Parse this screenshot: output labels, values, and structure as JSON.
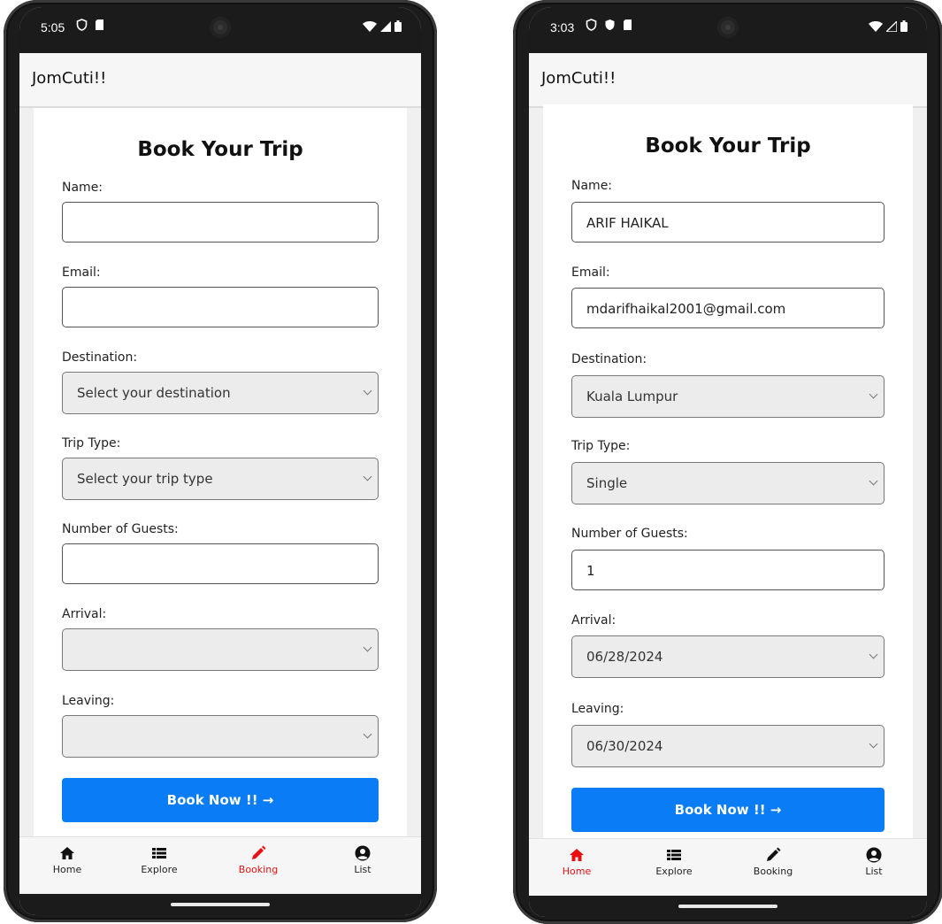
{
  "left_phone": {
    "status": {
      "time": "5:05"
    },
    "app_title": "JomCuti!!",
    "form": {
      "heading": "Book Your Trip",
      "name_label": "Name:",
      "name_value": "",
      "email_label": "Email:",
      "email_value": "",
      "destination_label": "Destination:",
      "destination_value": "Select your destination",
      "trip_type_label": "Trip Type:",
      "trip_type_value": "Select your trip type",
      "guests_label": "Number of Guests:",
      "guests_value": "",
      "arrival_label": "Arrival:",
      "arrival_value": "",
      "leaving_label": "Leaving:",
      "leaving_value": "",
      "book_button": "Book Now !! →"
    },
    "nav": {
      "items": [
        "Home",
        "Explore",
        "Booking",
        "List"
      ],
      "active": "Booking"
    }
  },
  "right_phone": {
    "status": {
      "time": "3:03"
    },
    "app_title": "JomCuti!!",
    "form": {
      "heading": "Book Your Trip",
      "name_label": "Name:",
      "name_value": "ARIF HAIKAL",
      "email_label": "Email:",
      "email_value": "mdarifhaikal2001@gmail.com",
      "destination_label": "Destination:",
      "destination_value": "Kuala Lumpur",
      "trip_type_label": "Trip Type:",
      "trip_type_value": "Single",
      "guests_label": "Number of Guests:",
      "guests_value": "1",
      "arrival_label": "Arrival:",
      "arrival_value": "06/28/2024",
      "leaving_label": "Leaving:",
      "leaving_value": "06/30/2024",
      "book_button": "Book Now !! →"
    },
    "nav": {
      "items": [
        "Home",
        "Explore",
        "Booking",
        "List"
      ],
      "active": "Home"
    }
  },
  "colors": {
    "accent_blue": "#0a7cf6",
    "active_red": "#e81010",
    "select_bg": "#ececec"
  },
  "icons": [
    "shield-icon",
    "sim-icon",
    "wifi-icon",
    "signal-icon",
    "battery-icon",
    "home-icon",
    "list-icon",
    "pencil-icon",
    "user-circle-icon"
  ]
}
